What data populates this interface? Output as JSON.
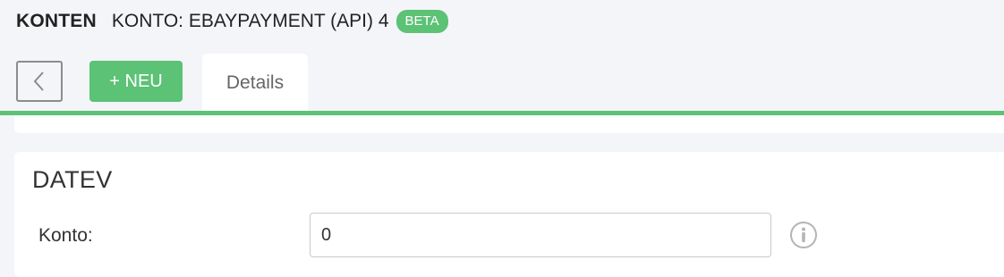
{
  "header": {
    "module_title": "KONTEN",
    "page_title": "KONTO: EBAYPAYMENT (API) 4",
    "badge": "BETA"
  },
  "toolbar": {
    "back_icon": "chevron-left-icon",
    "new_label": "+ NEU",
    "tabs": [
      {
        "label": "Details",
        "active": true
      }
    ]
  },
  "datev": {
    "title": "DATEV",
    "fields": [
      {
        "label": "Konto:",
        "value": "0",
        "help_icon": "info-icon"
      }
    ]
  },
  "colors": {
    "accent": "#5cc275",
    "background": "#f4f5f9",
    "card": "#ffffff"
  }
}
